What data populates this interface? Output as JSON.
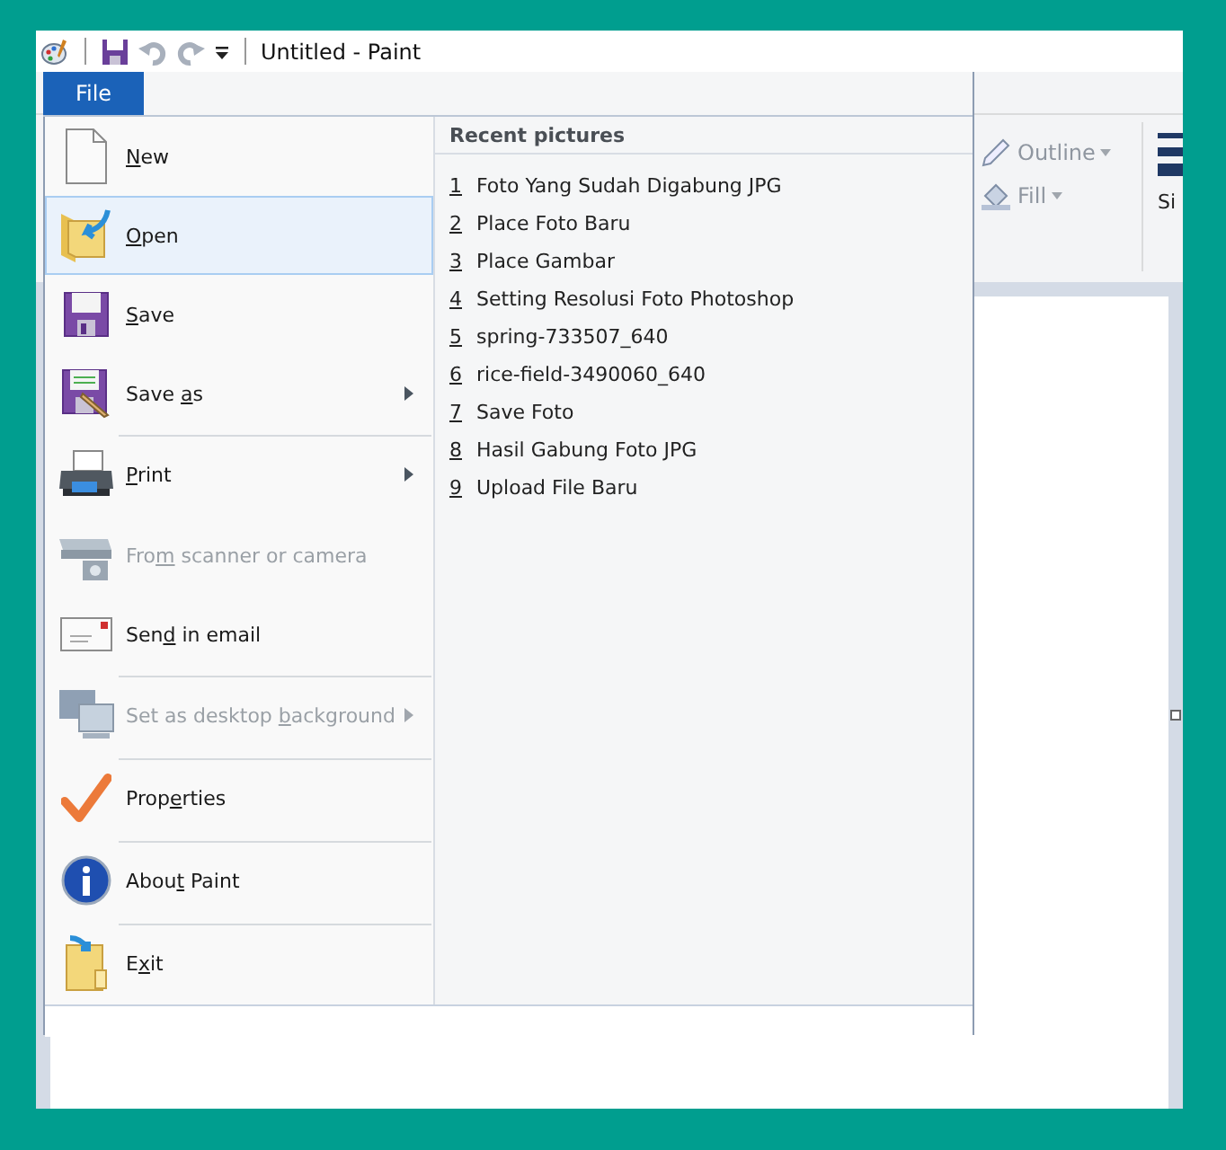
{
  "window": {
    "title": "Untitled - Paint"
  },
  "file_tab": {
    "label": "File",
    "selected": true
  },
  "ribbon": {
    "outline": "Outline",
    "fill": "Fill",
    "size_label": "Si"
  },
  "menu_items": [
    {
      "key": "N",
      "after": "ew",
      "selected": false,
      "disabled": false,
      "submenu": false,
      "separator_before": false
    },
    {
      "key": "O",
      "after": "pen",
      "selected": true,
      "disabled": false,
      "submenu": false,
      "separator_before": false
    },
    {
      "key": "S",
      "after": "ave",
      "selected": false,
      "disabled": false,
      "submenu": false,
      "separator_before": false
    },
    {
      "before": "Save ",
      "key": "a",
      "after": "s",
      "selected": false,
      "disabled": false,
      "submenu": true,
      "separator_before": false
    },
    {
      "key": "P",
      "after": "rint",
      "selected": false,
      "disabled": false,
      "submenu": true,
      "separator_before": true
    },
    {
      "before": "Fro",
      "key": "m",
      "after": " scanner or camera",
      "selected": false,
      "disabled": true,
      "submenu": false,
      "separator_before": false
    },
    {
      "before": "Sen",
      "key": "d",
      "after": " in email",
      "selected": false,
      "disabled": false,
      "submenu": false,
      "separator_before": false
    },
    {
      "before": "Set as desktop ",
      "key": "b",
      "after": "ackground",
      "selected": false,
      "disabled": true,
      "submenu": true,
      "separator_before": true
    },
    {
      "before": "Prop",
      "key": "e",
      "after": "rties",
      "selected": false,
      "disabled": false,
      "submenu": false,
      "separator_before": true
    },
    {
      "before": "Abou",
      "key": "t",
      "after": " Paint",
      "selected": false,
      "disabled": false,
      "submenu": false,
      "separator_before": true
    },
    {
      "before": "E",
      "key": "x",
      "after": "it",
      "selected": false,
      "disabled": false,
      "submenu": false,
      "separator_before": true
    }
  ],
  "recent": {
    "heading": "Recent pictures",
    "items": [
      {
        "number": "1",
        "name": "Foto Yang Sudah Digabung JPG"
      },
      {
        "number": "2",
        "name": "Place Foto Baru"
      },
      {
        "number": "3",
        "name": "Place Gambar"
      },
      {
        "number": "4",
        "name": "Setting Resolusi Foto Photoshop"
      },
      {
        "number": "5",
        "name": "spring-733507_640"
      },
      {
        "number": "6",
        "name": "rice-field-3490060_640"
      },
      {
        "number": "7",
        "name": "Save Foto"
      },
      {
        "number": "8",
        "name": "Hasil Gabung Foto JPG"
      },
      {
        "number": "9",
        "name": "Upload File Baru"
      }
    ]
  }
}
